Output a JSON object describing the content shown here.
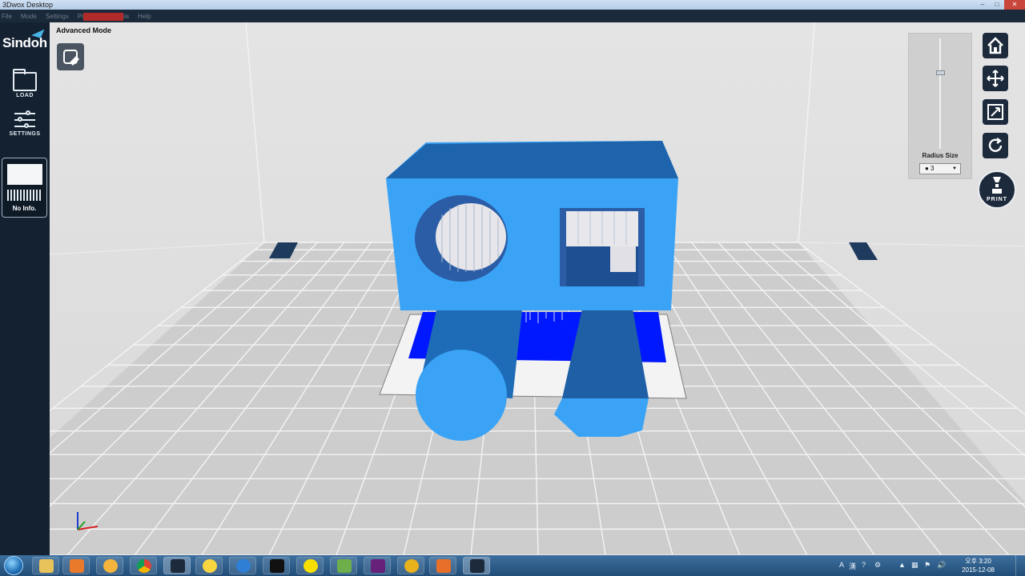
{
  "window": {
    "title": "3Dwox Desktop",
    "controls": [
      "–",
      "□",
      "✕"
    ]
  },
  "menu": [
    "File",
    "Mode",
    "Settings",
    "Printer",
    "Analysis",
    "Help"
  ],
  "sidebar": {
    "brand": "Sindoh",
    "load_label": "LOAD",
    "settings_label": "SETTINGS",
    "printer_info": "No Info."
  },
  "viewport": {
    "mode_label": "Advanced Mode",
    "colors": {
      "model": "#3aa3f5",
      "model_dark": "#1e6bb8",
      "support": "#0019ff",
      "grid": "#bdbdbd",
      "floor": "#cfcfcf"
    }
  },
  "radius_panel": {
    "label": "Radius Size",
    "value": "● 3",
    "slider_fraction": 0.7
  },
  "toolbar": {
    "icons": [
      "home-icon",
      "move-icon",
      "scale-icon",
      "rotate-icon"
    ],
    "print_label": "PRINT"
  },
  "taskbar": {
    "tray_ime": "A",
    "tray_ime2": "漢",
    "clock_time": "오후 3:20",
    "clock_date": "2015-12-08"
  }
}
